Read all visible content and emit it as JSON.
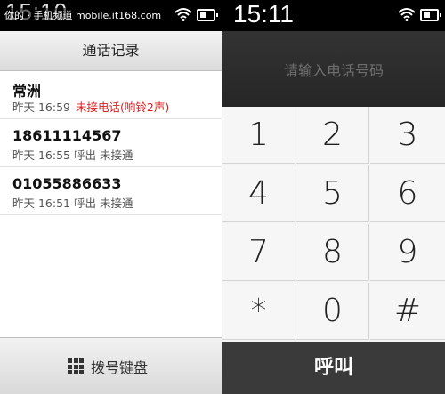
{
  "left_screen": {
    "status_time": "15:10",
    "watermark": "你的 · 手机频道 mobile.it168.com",
    "title": "通话记录",
    "calls": [
      {
        "name": "常洲",
        "time": "昨天 16:59",
        "status": "未接电话(响铃2声)",
        "missed": true
      },
      {
        "name": "18611114567",
        "time": "昨天 16:55",
        "status": "呼出 未接通",
        "missed": false
      },
      {
        "name": "01055886633",
        "time": "昨天 16:51",
        "status": "呼出 未接通",
        "missed": false
      }
    ],
    "dialpad_button": "拨号键盘"
  },
  "right_screen": {
    "status_time": "15:11",
    "number_placeholder": "请输入电话号码",
    "keys": [
      "1",
      "2",
      "3",
      "4",
      "5",
      "6",
      "7",
      "8",
      "9",
      "*",
      "0",
      "#"
    ],
    "call_button": "呼叫"
  },
  "colors": {
    "missed": "#d81e1e",
    "call_bar": "#3a3a3a"
  }
}
